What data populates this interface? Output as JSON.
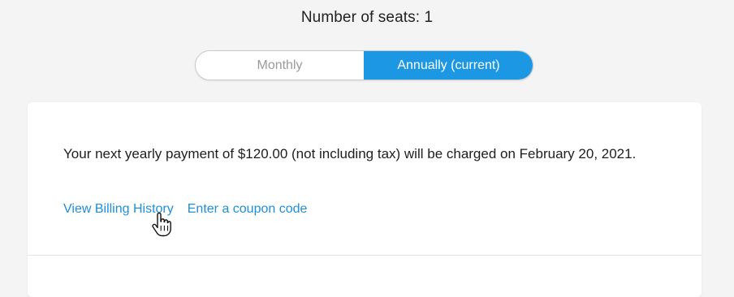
{
  "seats": {
    "title": "Number of seats: 1"
  },
  "billing_toggle": {
    "monthly_label": "Monthly",
    "annual_label": "Annually (current)",
    "selected": "annual"
  },
  "payment": {
    "message": "Your next yearly payment of $120.00 (not including tax) will be charged on February 20, 2021."
  },
  "links": {
    "billing_history": "View Billing History",
    "coupon": "Enter a coupon code"
  },
  "colors": {
    "accent": "#1c97e4",
    "link": "#1f8fd9",
    "background": "#f4f4f4"
  },
  "icons": {
    "cursor": "hand-pointer-icon"
  }
}
